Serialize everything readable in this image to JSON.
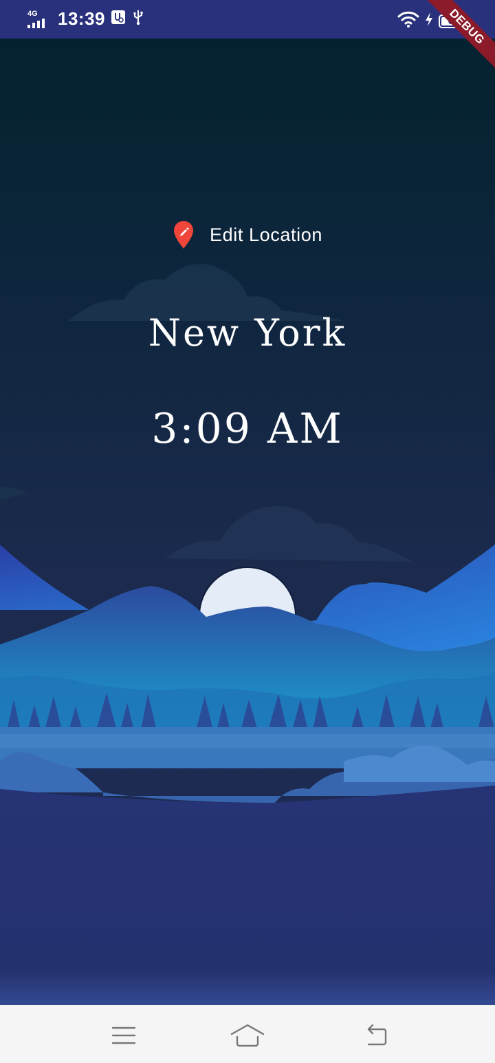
{
  "status_bar": {
    "network": "4G",
    "time": "13:39",
    "battery_level": "67",
    "icons": [
      "signal-icon",
      "usb-debug-icon",
      "usb-icon",
      "wifi-icon",
      "charging-icon",
      "battery-icon"
    ]
  },
  "debug_banner": {
    "text": "DEBUG"
  },
  "main": {
    "edit_location_label": "Edit Location",
    "city": "New York",
    "time": "3:09 AM",
    "is_daytime": false
  },
  "colors": {
    "status_bar": "#2a317c",
    "pin": "#f0453a",
    "sky_top": "#03222f",
    "sky_bottom": "#1e2a50",
    "moon": "#e4ecf8",
    "ground": "#243070",
    "debug_banner": "#8b1a2a"
  },
  "nav_bar": {
    "icons": [
      "menu-icon",
      "home-icon",
      "back-icon"
    ]
  }
}
